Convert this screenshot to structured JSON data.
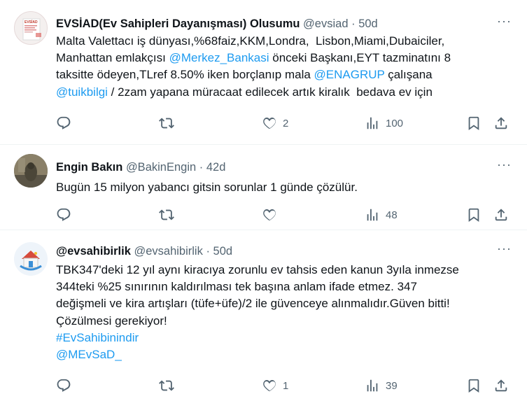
{
  "tweets": [
    {
      "name": "EVSİAD(Ev Sahipleri Dayanışması) Olusumu",
      "handle": "@evsiad",
      "dot": "·",
      "time": "50d",
      "lines": [
        [
          "Malta Valettacı iş dünyası,%68faiz,KKM,Londra,  Lisbon,Miami,Dubaiciler,"
        ],
        [
          "Manhattan emlakçısı ",
          {
            "link": "@Merkez_Bankasi"
          },
          " önceki Başkanı,EYT tazminatını 8"
        ],
        [
          "taksitte ödeyen,TLref 8.50% iken borçlanıp mala ",
          {
            "link": "@ENAGRUP"
          },
          " çalışana"
        ],
        [
          {
            "link": "@tuikbilgi"
          },
          " / 2zam yapana müracaat edilecek artık kiralık  bedava ev için"
        ]
      ],
      "replies": "",
      "retweets": "",
      "likes": "2",
      "views": "100"
    },
    {
      "name": "Engin Bakın",
      "handle": "@BakinEngin",
      "dot": "·",
      "time": "42d",
      "lines": [
        [
          "Bugün 15 milyon yabancı gitsin sorunlar 1 günde çözülür."
        ]
      ],
      "replies": "",
      "retweets": "",
      "likes": "",
      "views": "48"
    },
    {
      "name": "@evsahibirlik",
      "handle": "@evsahibirlik",
      "dot": "·",
      "time": "50d",
      "lines": [
        [
          "TBK347'deki 12 yıl aynı kiracıya zorunlu ev tahsis eden kanun 3yıla inmezse"
        ],
        [
          "344teki %25 sınırının kaldırılması tek başına anlam ifade etmez. 347"
        ],
        [
          "değişmeli ve kira artışları (tüfe+üfe)/2 ile güvenceye alınmalıdır.Güven bitti!"
        ],
        [
          "Çözülmesi gerekiyor!"
        ],
        [
          {
            "link": "#EvSahibinindir"
          }
        ],
        [
          {
            "link": "@MEvSaD_"
          }
        ]
      ],
      "replies": "",
      "retweets": "",
      "likes": "1",
      "views": "39"
    }
  ],
  "icons": {
    "reply": "reply-icon",
    "retweet": "retweet-icon",
    "like": "heart-icon",
    "views": "views-icon",
    "bookmark": "bookmark-icon",
    "share": "share-icon",
    "more": "more-icon"
  },
  "colors": {
    "text": "#0f1419",
    "secondary": "#536471",
    "link": "#1d9bf0",
    "border": "#eff3f4"
  }
}
